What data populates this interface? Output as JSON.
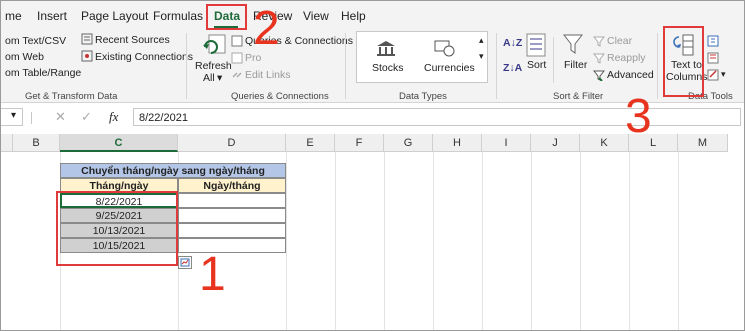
{
  "tabs": [
    "me",
    "Insert",
    "Page Layout",
    "Formulas",
    "Data",
    "Review",
    "View",
    "Help"
  ],
  "ribbon": {
    "get_transform": {
      "items": [
        "om Text/CSV",
        "om Web",
        "om Table/Range",
        "Recent Sources",
        "Existing Connections"
      ],
      "label": "Get & Transform Data"
    },
    "queries": {
      "refresh": "Refresh",
      "refresh_all": "All",
      "queries_connections": "Queries & Connections",
      "properties": "Pro",
      "edit_links": "Edit Links",
      "label": "Queries & Connections"
    },
    "data_types": {
      "stocks": "Stocks",
      "currencies": "Currencies",
      "label": "Data Types"
    },
    "sort_filter": {
      "sort": "Sort",
      "filter": "Filter",
      "clear": "Clear",
      "reapply": "Reapply",
      "advanced": "Advanced",
      "label": "Sort & Filter"
    },
    "data_tools": {
      "text_to_columns_1": "Text to",
      "text_to_columns_2": "Columns",
      "label": "Data Tools"
    }
  },
  "formula_bar": {
    "fx": "fx",
    "value": "8/22/2021"
  },
  "columns": [
    "B",
    "C",
    "D",
    "E",
    "F",
    "G",
    "H",
    "I",
    "J",
    "K",
    "L",
    "M"
  ],
  "selected_column": "C",
  "table": {
    "title": "Chuyển tháng/ngày sang ngày/tháng",
    "col1": "Tháng/ngày",
    "col2": "Ngày/tháng",
    "dates": [
      "8/22/2021",
      "9/25/2021",
      "10/13/2021",
      "10/15/2021"
    ]
  },
  "steps": [
    "1",
    "2",
    "3"
  ],
  "colors": {
    "accent": "#1e6b3a",
    "callout": "#e8341f",
    "title_fill": "#b4c6e7",
    "header_fill": "#fff2cc"
  }
}
